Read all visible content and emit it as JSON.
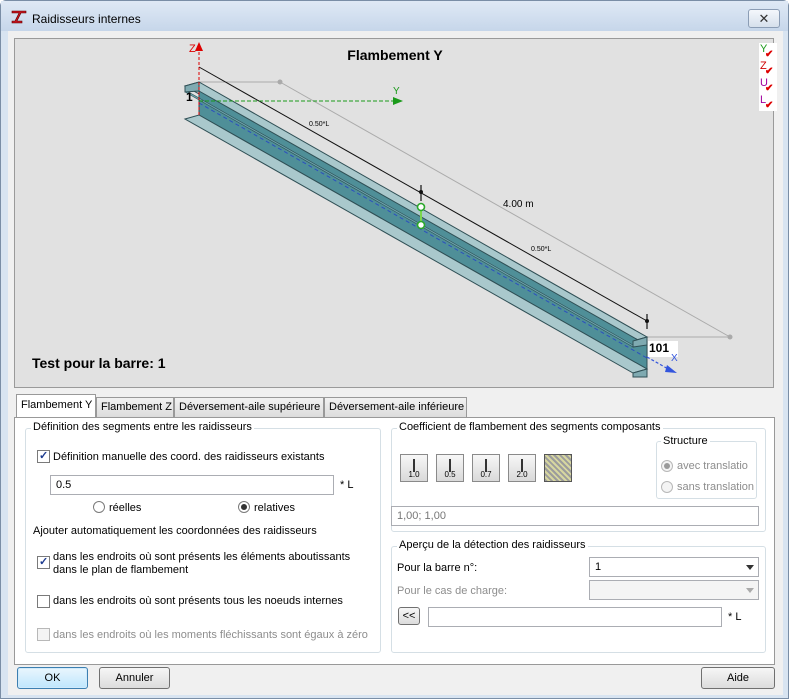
{
  "window": {
    "title": "Raidisseurs internes",
    "close_label": "✕"
  },
  "view": {
    "title": "Flambement Y",
    "test_label": "Test pour la barre: 1",
    "axis_z": "Z",
    "axis_y": "Y",
    "axis_x": "X",
    "node_start": "1",
    "node_end": "101",
    "ratio_label_1": "0.50*L",
    "ratio_label_2": "0.50*L",
    "length_label": "4.00  m",
    "indicators": [
      {
        "letter": "Y",
        "color": "#1a9a1a"
      },
      {
        "letter": "Z",
        "color": "#d00000"
      },
      {
        "letter": "U",
        "color": "#a000a0"
      },
      {
        "letter": "L",
        "color": "#a000a0"
      }
    ]
  },
  "tabs": [
    {
      "label": "Flambement Y",
      "active": true
    },
    {
      "label": "Flambement Z",
      "active": false
    },
    {
      "label": "Déversement-aile supérieure",
      "active": false
    },
    {
      "label": "Déversement-aile inférieure",
      "active": false
    }
  ],
  "segments": {
    "legend": "Définition des segments entre les raidisseurs",
    "manual_label": "Définition manuelle des coord. des raidisseurs existants",
    "value": "0.5",
    "unit": "* L",
    "radio_real": "réelles",
    "radio_relative": "relatives"
  },
  "auto": {
    "legend": "Ajouter automatiquement les coordonnées des raidisseurs",
    "opt1_line1": "dans les endroits où sont présents les éléments aboutissants",
    "opt1_line2": "dans le plan de flambement",
    "opt2": "dans les endroits où sont présents tous les noeuds internes",
    "opt3": "dans les endroits où les moments fléchissants sont égaux à zéro"
  },
  "coef": {
    "legend": "Coefficient de flambement des segments composants",
    "buttons": [
      "1.0",
      "0.5",
      "0.7",
      "2.0",
      ""
    ],
    "values": "1,00; 1,00",
    "structure_legend": "Structure",
    "with_translation": "avec translatio",
    "without_translation": "sans translation"
  },
  "preview": {
    "legend": "Aperçu de la détection des raidisseurs",
    "bar_label": "Pour la barre n°:",
    "bar_value": "1",
    "load_label": "Pour le cas de charge:",
    "load_value": "",
    "copy_button": "<<",
    "field_value": "",
    "unit": "* L"
  },
  "buttons": {
    "ok": "OK",
    "cancel": "Annuler",
    "help": "Aide"
  }
}
